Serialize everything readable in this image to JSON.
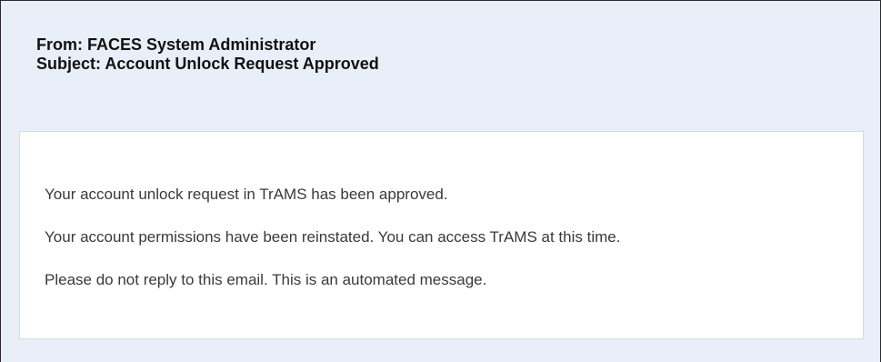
{
  "email": {
    "from_line": "From: FACES System Administrator",
    "subject_line": "Subject: Account Unlock Request Approved",
    "body_lines": [
      "Your account unlock request in TrAMS has been approved.",
      "Your account permissions have been reinstated. You can access TrAMS at this time.",
      "Please do not reply to this email. This is an automated message."
    ]
  },
  "colors": {
    "header_background": "#e9eff8",
    "body_background": "#ffffff",
    "border": "#2b2b2b",
    "text": "#3a3a3a"
  }
}
